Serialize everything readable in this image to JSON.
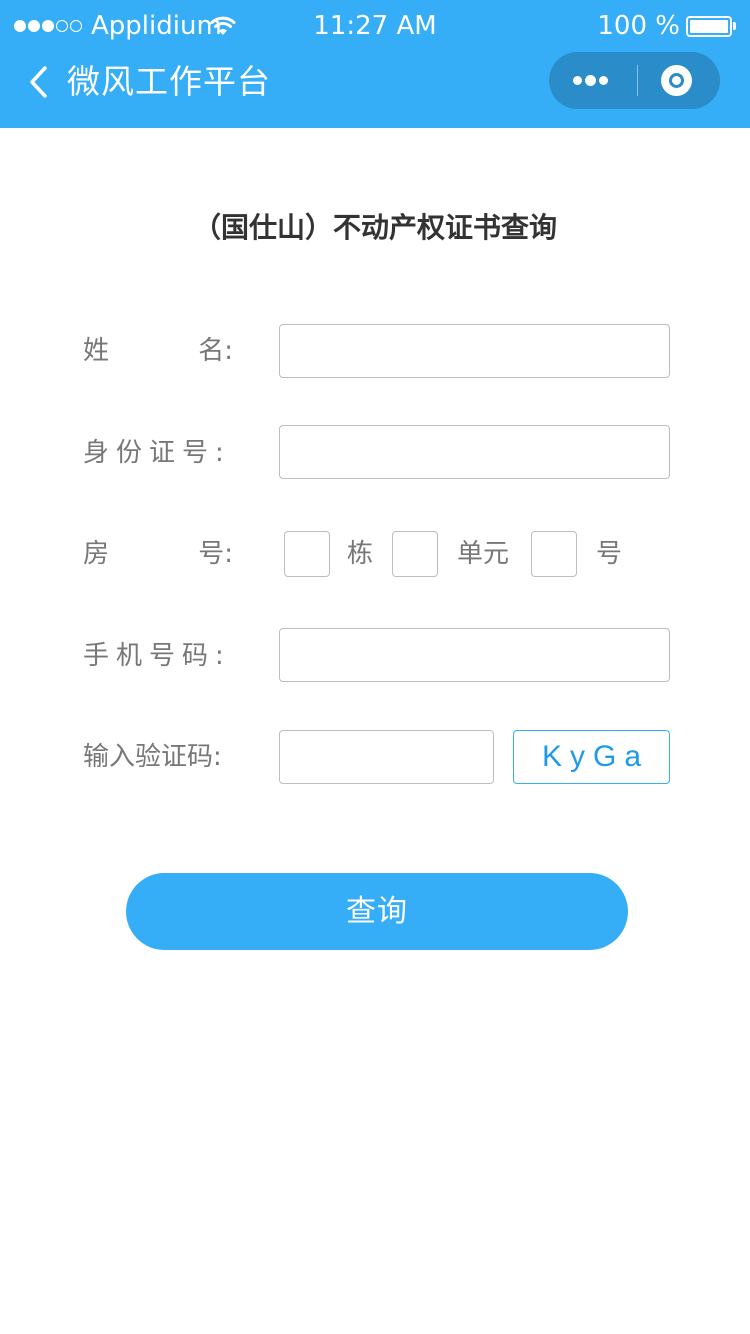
{
  "status_bar": {
    "carrier": "Applidium",
    "time": "11:27 AM",
    "battery": "100 %",
    "signal_bars_filled": 3,
    "signal_bars_total": 5
  },
  "nav": {
    "title": "微风工作平台",
    "back_icon": "chevron-left-icon",
    "menu_icon": "more-dots-icon",
    "close_icon": "record-circle-icon"
  },
  "page": {
    "title": "（国仕山）不动产权证书查询"
  },
  "form": {
    "name": {
      "label_start": "姓",
      "label_end": "名:",
      "value": ""
    },
    "id_number": {
      "label": "身份证号:",
      "value": ""
    },
    "room": {
      "label_start": "房",
      "label_end": "号:",
      "building_unit": "栋",
      "unit_unit": "单元",
      "room_unit": "号",
      "building_value": "",
      "unit_value": "",
      "room_value": ""
    },
    "phone": {
      "label": "手机号码:",
      "value": ""
    },
    "captcha": {
      "label": "输入验证码:",
      "value": "",
      "code": "KyGa"
    }
  },
  "actions": {
    "query_label": "查询"
  },
  "colors": {
    "primary": "#35adf7",
    "capsule": "#2a8dc9",
    "label_text": "#777777",
    "title_text": "#333333"
  }
}
